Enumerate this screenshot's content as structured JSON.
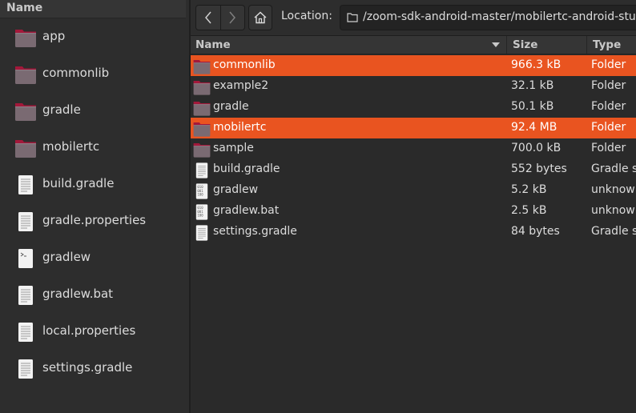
{
  "left_pane": {
    "header": "Name",
    "items": [
      {
        "label": "app",
        "kind": "folder"
      },
      {
        "label": "commonlib",
        "kind": "folder"
      },
      {
        "label": "gradle",
        "kind": "folder"
      },
      {
        "label": "mobilertc",
        "kind": "folder"
      },
      {
        "label": "build.gradle",
        "kind": "text"
      },
      {
        "label": "gradle.properties",
        "kind": "text"
      },
      {
        "label": "gradlew",
        "kind": "script"
      },
      {
        "label": "gradlew.bat",
        "kind": "text"
      },
      {
        "label": "local.properties",
        "kind": "text"
      },
      {
        "label": "settings.gradle",
        "kind": "text"
      }
    ]
  },
  "toolbar": {
    "back_icon": "chevron-left-icon",
    "forward_icon": "chevron-right-icon",
    "home_icon": "home-icon",
    "location_label": "Location:",
    "location_path": "/zoom-sdk-android-master/mobilertc-android-studio/"
  },
  "list": {
    "columns": {
      "name": "Name",
      "size": "Size",
      "type": "Type"
    },
    "rows": [
      {
        "name": "commonlib",
        "size": "966.3 kB",
        "type": "Folder",
        "kind": "folder",
        "selected": true
      },
      {
        "name": "example2",
        "size": "32.1 kB",
        "type": "Folder",
        "kind": "folder",
        "selected": false
      },
      {
        "name": "gradle",
        "size": "50.1 kB",
        "type": "Folder",
        "kind": "folder",
        "selected": false
      },
      {
        "name": "mobilertc",
        "size": "92.4 MB",
        "type": "Folder",
        "kind": "folder",
        "selected": true
      },
      {
        "name": "sample",
        "size": "700.0 kB",
        "type": "Folder",
        "kind": "folder",
        "selected": false
      },
      {
        "name": "build.gradle",
        "size": "552 bytes",
        "type": "Gradle script",
        "kind": "text",
        "selected": false
      },
      {
        "name": "gradlew",
        "size": "5.2 kB",
        "type": "unknown",
        "kind": "binary",
        "selected": false
      },
      {
        "name": "gradlew.bat",
        "size": "2.5 kB",
        "type": "unknown",
        "kind": "binary",
        "selected": false
      },
      {
        "name": "settings.gradle",
        "size": "84 bytes",
        "type": "Gradle script",
        "kind": "text",
        "selected": false
      }
    ]
  },
  "colors": {
    "selection": "#e95420",
    "folder_body": "#7a6a72",
    "folder_tab": "#a3183a"
  }
}
